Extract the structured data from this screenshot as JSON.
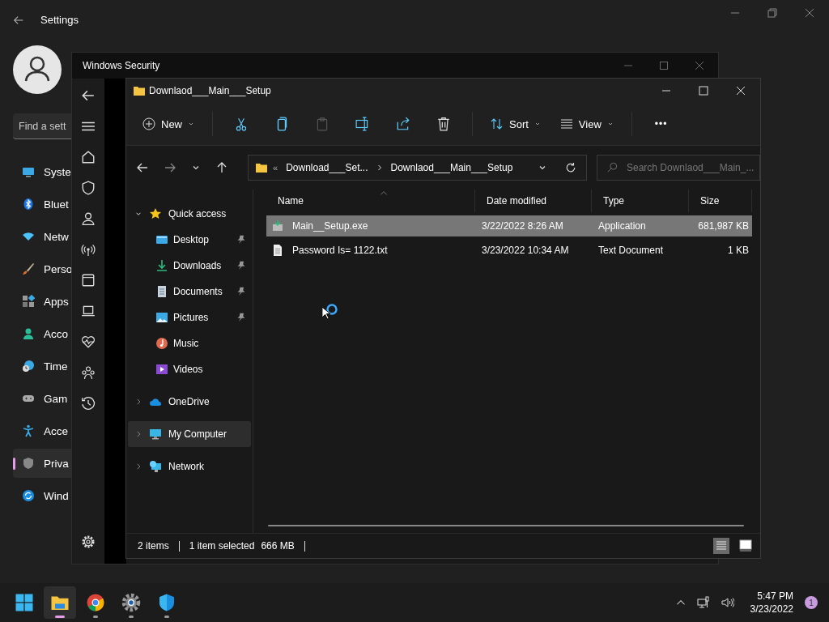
{
  "settings": {
    "title": "Settings",
    "search": {
      "placeholder": "Find a sett"
    },
    "nav": [
      {
        "label": "Syste",
        "kind": "display",
        "selected": false
      },
      {
        "label": "Bluet",
        "kind": "bluetooth",
        "selected": false
      },
      {
        "label": "Netw",
        "kind": "wifi",
        "selected": false
      },
      {
        "label": "Perso",
        "kind": "brush",
        "selected": false
      },
      {
        "label": "Apps",
        "kind": "apps",
        "selected": false
      },
      {
        "label": "Acco",
        "kind": "person",
        "selected": false
      },
      {
        "label": "Time",
        "kind": "clock",
        "selected": false
      },
      {
        "label": "Gam",
        "kind": "gamepad",
        "selected": false
      },
      {
        "label": "Acce",
        "kind": "accessibility",
        "selected": false
      },
      {
        "label": "Priva",
        "kind": "shield",
        "selected": true
      },
      {
        "label": "Wind",
        "kind": "update",
        "selected": false
      }
    ]
  },
  "security_window": {
    "title": "Windows Security"
  },
  "explorer": {
    "title": "Downlaod___Main___Setup",
    "toolbar": {
      "new": "New",
      "sort": "Sort",
      "view": "View",
      "more": "•••"
    },
    "address": {
      "overflow": "«",
      "crumbs": [
        "Download___Set...",
        "Downlaod___Main___Setup"
      ]
    },
    "search": {
      "placeholder": "Search Downlaod___Main_..."
    },
    "tree": [
      {
        "label": "Quick access",
        "kind": "star",
        "expanded": true,
        "selected": false,
        "children": [
          {
            "label": "Desktop",
            "kind": "desktop",
            "pinned": true
          },
          {
            "label": "Downloads",
            "kind": "download",
            "pinned": true
          },
          {
            "label": "Documents",
            "kind": "document",
            "pinned": true
          },
          {
            "label": "Pictures",
            "kind": "picture",
            "pinned": true
          },
          {
            "label": "Music",
            "kind": "music",
            "pinned": false
          },
          {
            "label": "Videos",
            "kind": "video",
            "pinned": false
          }
        ]
      },
      {
        "label": "OneDrive",
        "kind": "cloud",
        "expanded": false,
        "selected": false
      },
      {
        "label": "My Computer",
        "kind": "computer",
        "expanded": false,
        "selected": true
      },
      {
        "label": "Network",
        "kind": "network",
        "expanded": false,
        "selected": false
      }
    ],
    "columns": [
      "Name",
      "Date modified",
      "Type",
      "Size"
    ],
    "rows": [
      {
        "name": "Main__Setup.exe",
        "kind": "exe",
        "date": "3/22/2022 8:26 AM",
        "type": "Application",
        "size": "681,987 KB",
        "selected": true
      },
      {
        "name": "Password Is= 1122.txt",
        "kind": "txt",
        "date": "3/23/2022 10:34 AM",
        "type": "Text Document",
        "size": "1 KB",
        "selected": false
      }
    ],
    "status": {
      "count": "2 items",
      "selection": "1 item selected",
      "size": "666 MB"
    },
    "views": [
      {
        "kind": "details",
        "selected": true
      },
      {
        "kind": "tiles",
        "selected": false
      }
    ]
  },
  "taskbar": {
    "apps": [
      {
        "kind": "start",
        "running": false,
        "selected": false
      },
      {
        "kind": "folder",
        "running": true,
        "selected": true
      },
      {
        "kind": "chrome",
        "running": true,
        "selected": false
      },
      {
        "kind": "gear",
        "running": true,
        "selected": false
      },
      {
        "kind": "shield",
        "running": true,
        "selected": false
      }
    ],
    "time": "5:47 PM",
    "date": "3/23/2022",
    "notifications": "1"
  }
}
